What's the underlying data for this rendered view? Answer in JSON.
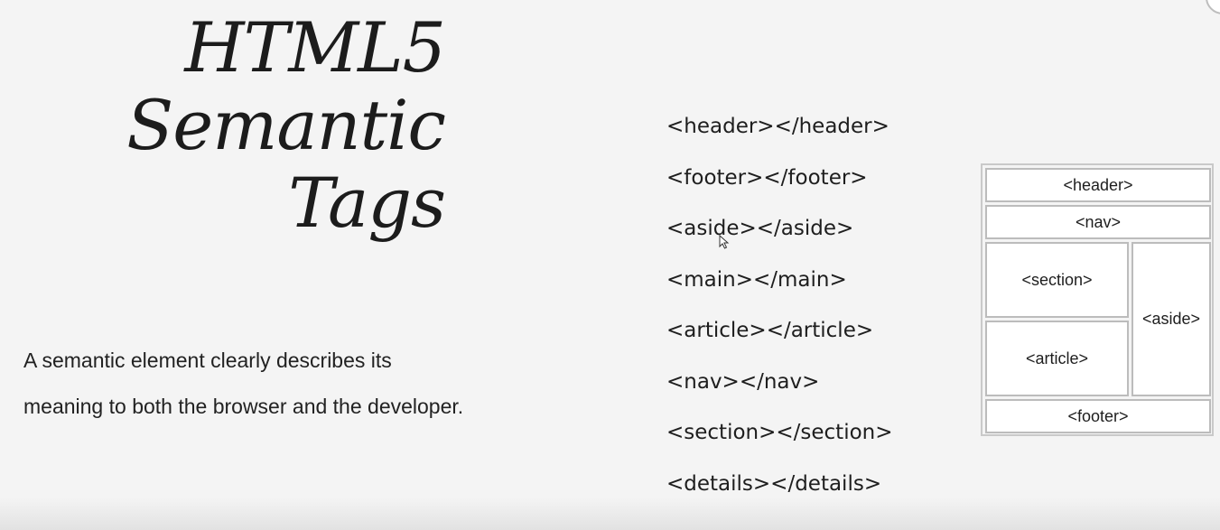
{
  "slide": {
    "title_lines": [
      "HTML5",
      "Semantic",
      "Tags"
    ],
    "description": "A semantic element clearly describes its meaning to both the browser and the developer.",
    "tags": [
      "<header></header>",
      "<footer></footer>",
      "<aside></aside>",
      "<main></main>",
      "<article></article>",
      "<nav></nav>",
      "<section></section>",
      "<details></details>"
    ]
  },
  "diagram": {
    "header": "<header>",
    "nav": "<nav>",
    "section": "<section>",
    "article": "<article>",
    "aside": "<aside>",
    "footer": "<footer>"
  },
  "icons": {
    "cursor": "mouse-pointer-icon"
  },
  "colors": {
    "background": "#f4f4f4",
    "box_border": "#bcbcbc",
    "box_fill": "#ffffff"
  }
}
